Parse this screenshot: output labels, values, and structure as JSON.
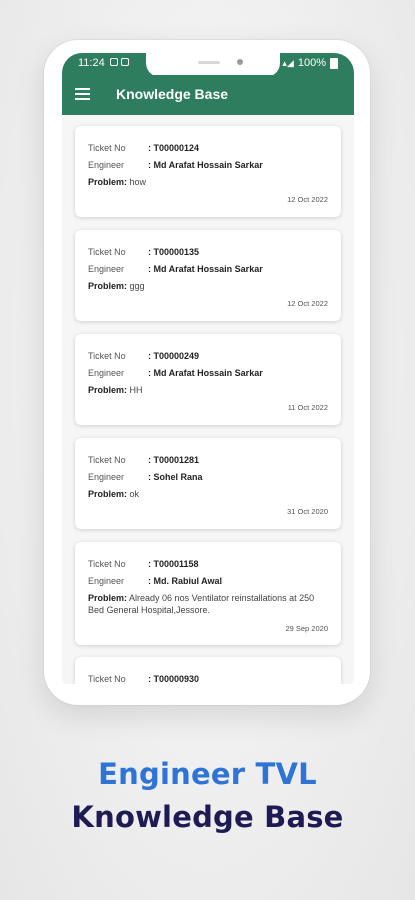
{
  "status_bar": {
    "time": "11:24",
    "battery": "100%"
  },
  "app_bar": {
    "title": "Knowledge Base"
  },
  "labels": {
    "ticket": "Ticket No",
    "engineer": "Engineer",
    "problem": "Problem:"
  },
  "tickets": [
    {
      "ticket_no": ": T00000124",
      "engineer": ": Md Arafat Hossain Sarkar",
      "problem": "how",
      "date": "12 Oct 2022"
    },
    {
      "ticket_no": ": T00000135",
      "engineer": ": Md Arafat Hossain Sarkar",
      "problem": "ggg",
      "date": "12 Oct 2022"
    },
    {
      "ticket_no": ": T00000249",
      "engineer": ": Md Arafat Hossain Sarkar",
      "problem": "HH",
      "date": "11 Oct 2022"
    },
    {
      "ticket_no": ": T00001281",
      "engineer": ": Sohel Rana",
      "problem": "ok",
      "date": "31 Oct 2020"
    },
    {
      "ticket_no": ": T00001158",
      "engineer": ": Md. Rabiul Awal",
      "problem": "Already 06 nos Ventilator reinstallations at 250 Bed General Hospital,Jessore.",
      "date": "29 Sep 2020"
    },
    {
      "ticket_no": ": T00000930"
    }
  ],
  "footer": {
    "line1": "Engineer TVL",
    "line2": "Knowledge Base"
  },
  "colors": {
    "primary": "#2e7d5e",
    "footer_blue": "#2e73d6",
    "footer_navy": "#1e1b54"
  }
}
